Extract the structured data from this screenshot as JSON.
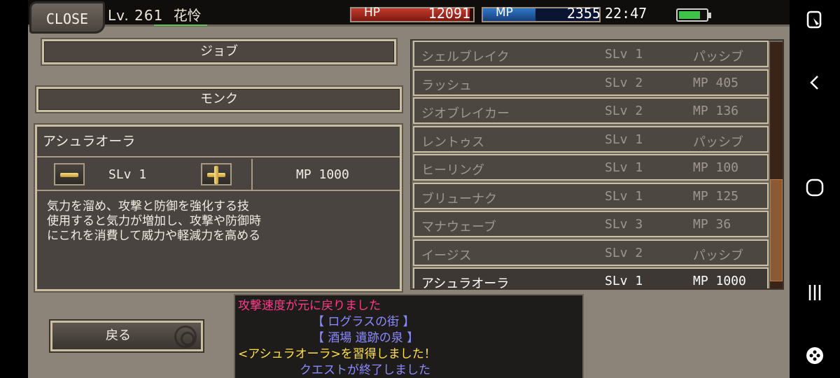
{
  "header": {
    "close_label": "CLOSE",
    "level_label": "Lv. 261",
    "player_name": "花怜",
    "hp_label": "HP",
    "hp_value": "12091",
    "hp_fill_fraction": 0.97,
    "mp_label": "MP",
    "mp_value": "2355",
    "mp_fill_fraction": 0.45,
    "clock": "22:47",
    "battery_fraction": 0.8,
    "hp_color": "#c23a2c",
    "mp_color": "#2d78c8"
  },
  "job": {
    "label": "ジョブ",
    "value": "モンク"
  },
  "selected_skill": {
    "name": "アシュラオーラ",
    "slv_text": "SLv  1",
    "mp_text": "MP  1000",
    "description": [
      "気力を溜め、攻撃と防御を強化する技",
      "使用すると気力が増加し、攻撃や防御時",
      "にこれを消費して威力や軽減力を高める"
    ]
  },
  "back_label": "戻る",
  "skills": [
    {
      "name": "シェルブレイク",
      "slv": "SLv  1",
      "cost": "パッシブ",
      "selected": false
    },
    {
      "name": "ラッシュ",
      "slv": "SLv  2",
      "cost": "MP  405",
      "selected": false
    },
    {
      "name": "ジオブレイカー",
      "slv": "SLv  2",
      "cost": "MP  136",
      "selected": false
    },
    {
      "name": "レントゥス",
      "slv": "SLv  1",
      "cost": "パッシブ",
      "selected": false
    },
    {
      "name": "ヒーリング",
      "slv": "SLv  1",
      "cost": "MP  100",
      "selected": false
    },
    {
      "name": "ブリューナク",
      "slv": "SLv  1",
      "cost": "MP  125",
      "selected": false
    },
    {
      "name": "マナウェーブ",
      "slv": "SLv  3",
      "cost": "MP  36",
      "selected": false
    },
    {
      "name": "イージス",
      "slv": "SLv  2",
      "cost": "パッシブ",
      "selected": false
    },
    {
      "name": "アシュラオーラ",
      "slv": "SLv  1",
      "cost": "MP  1000",
      "selected": true
    }
  ],
  "log": [
    {
      "text": "攻撃速度が元に戻りました",
      "color": "#ff3c8c"
    },
    {
      "text": "【  ログラスの街  】",
      "color": "#8a8aff"
    },
    {
      "text": "【  酒場  遺跡の泉  】",
      "color": "#8a8aff"
    },
    {
      "text": "<アシュラオーラ>を習得しました！",
      "color": "#ffe14a"
    },
    {
      "text": "クエストが終了しました",
      "color": "#8a8aff"
    }
  ],
  "system_nav": {
    "icons": [
      "screenshot-edit-icon",
      "back-icon",
      "home-icon",
      "recents-icon",
      "game-tools-icon"
    ]
  }
}
